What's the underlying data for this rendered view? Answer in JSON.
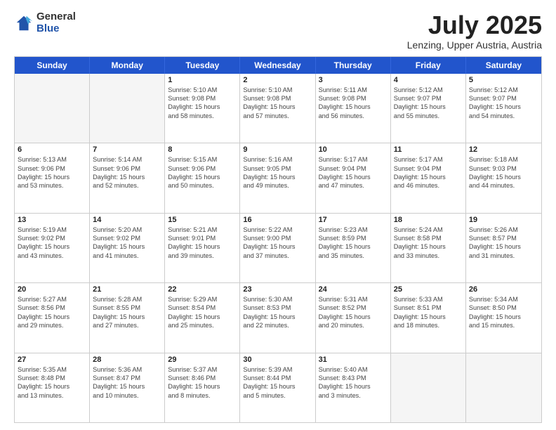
{
  "logo": {
    "general": "General",
    "blue": "Blue"
  },
  "header": {
    "title": "July 2025",
    "subtitle": "Lenzing, Upper Austria, Austria"
  },
  "weekdays": [
    "Sunday",
    "Monday",
    "Tuesday",
    "Wednesday",
    "Thursday",
    "Friday",
    "Saturday"
  ],
  "rows": [
    [
      {
        "day": "",
        "lines": [],
        "empty": true
      },
      {
        "day": "",
        "lines": [],
        "empty": true
      },
      {
        "day": "1",
        "lines": [
          "Sunrise: 5:10 AM",
          "Sunset: 9:08 PM",
          "Daylight: 15 hours",
          "and 58 minutes."
        ],
        "empty": false
      },
      {
        "day": "2",
        "lines": [
          "Sunrise: 5:10 AM",
          "Sunset: 9:08 PM",
          "Daylight: 15 hours",
          "and 57 minutes."
        ],
        "empty": false
      },
      {
        "day": "3",
        "lines": [
          "Sunrise: 5:11 AM",
          "Sunset: 9:08 PM",
          "Daylight: 15 hours",
          "and 56 minutes."
        ],
        "empty": false
      },
      {
        "day": "4",
        "lines": [
          "Sunrise: 5:12 AM",
          "Sunset: 9:07 PM",
          "Daylight: 15 hours",
          "and 55 minutes."
        ],
        "empty": false
      },
      {
        "day": "5",
        "lines": [
          "Sunrise: 5:12 AM",
          "Sunset: 9:07 PM",
          "Daylight: 15 hours",
          "and 54 minutes."
        ],
        "empty": false
      }
    ],
    [
      {
        "day": "6",
        "lines": [
          "Sunrise: 5:13 AM",
          "Sunset: 9:06 PM",
          "Daylight: 15 hours",
          "and 53 minutes."
        ],
        "empty": false
      },
      {
        "day": "7",
        "lines": [
          "Sunrise: 5:14 AM",
          "Sunset: 9:06 PM",
          "Daylight: 15 hours",
          "and 52 minutes."
        ],
        "empty": false
      },
      {
        "day": "8",
        "lines": [
          "Sunrise: 5:15 AM",
          "Sunset: 9:06 PM",
          "Daylight: 15 hours",
          "and 50 minutes."
        ],
        "empty": false
      },
      {
        "day": "9",
        "lines": [
          "Sunrise: 5:16 AM",
          "Sunset: 9:05 PM",
          "Daylight: 15 hours",
          "and 49 minutes."
        ],
        "empty": false
      },
      {
        "day": "10",
        "lines": [
          "Sunrise: 5:17 AM",
          "Sunset: 9:04 PM",
          "Daylight: 15 hours",
          "and 47 minutes."
        ],
        "empty": false
      },
      {
        "day": "11",
        "lines": [
          "Sunrise: 5:17 AM",
          "Sunset: 9:04 PM",
          "Daylight: 15 hours",
          "and 46 minutes."
        ],
        "empty": false
      },
      {
        "day": "12",
        "lines": [
          "Sunrise: 5:18 AM",
          "Sunset: 9:03 PM",
          "Daylight: 15 hours",
          "and 44 minutes."
        ],
        "empty": false
      }
    ],
    [
      {
        "day": "13",
        "lines": [
          "Sunrise: 5:19 AM",
          "Sunset: 9:02 PM",
          "Daylight: 15 hours",
          "and 43 minutes."
        ],
        "empty": false
      },
      {
        "day": "14",
        "lines": [
          "Sunrise: 5:20 AM",
          "Sunset: 9:02 PM",
          "Daylight: 15 hours",
          "and 41 minutes."
        ],
        "empty": false
      },
      {
        "day": "15",
        "lines": [
          "Sunrise: 5:21 AM",
          "Sunset: 9:01 PM",
          "Daylight: 15 hours",
          "and 39 minutes."
        ],
        "empty": false
      },
      {
        "day": "16",
        "lines": [
          "Sunrise: 5:22 AM",
          "Sunset: 9:00 PM",
          "Daylight: 15 hours",
          "and 37 minutes."
        ],
        "empty": false
      },
      {
        "day": "17",
        "lines": [
          "Sunrise: 5:23 AM",
          "Sunset: 8:59 PM",
          "Daylight: 15 hours",
          "and 35 minutes."
        ],
        "empty": false
      },
      {
        "day": "18",
        "lines": [
          "Sunrise: 5:24 AM",
          "Sunset: 8:58 PM",
          "Daylight: 15 hours",
          "and 33 minutes."
        ],
        "empty": false
      },
      {
        "day": "19",
        "lines": [
          "Sunrise: 5:26 AM",
          "Sunset: 8:57 PM",
          "Daylight: 15 hours",
          "and 31 minutes."
        ],
        "empty": false
      }
    ],
    [
      {
        "day": "20",
        "lines": [
          "Sunrise: 5:27 AM",
          "Sunset: 8:56 PM",
          "Daylight: 15 hours",
          "and 29 minutes."
        ],
        "empty": false
      },
      {
        "day": "21",
        "lines": [
          "Sunrise: 5:28 AM",
          "Sunset: 8:55 PM",
          "Daylight: 15 hours",
          "and 27 minutes."
        ],
        "empty": false
      },
      {
        "day": "22",
        "lines": [
          "Sunrise: 5:29 AM",
          "Sunset: 8:54 PM",
          "Daylight: 15 hours",
          "and 25 minutes."
        ],
        "empty": false
      },
      {
        "day": "23",
        "lines": [
          "Sunrise: 5:30 AM",
          "Sunset: 8:53 PM",
          "Daylight: 15 hours",
          "and 22 minutes."
        ],
        "empty": false
      },
      {
        "day": "24",
        "lines": [
          "Sunrise: 5:31 AM",
          "Sunset: 8:52 PM",
          "Daylight: 15 hours",
          "and 20 minutes."
        ],
        "empty": false
      },
      {
        "day": "25",
        "lines": [
          "Sunrise: 5:33 AM",
          "Sunset: 8:51 PM",
          "Daylight: 15 hours",
          "and 18 minutes."
        ],
        "empty": false
      },
      {
        "day": "26",
        "lines": [
          "Sunrise: 5:34 AM",
          "Sunset: 8:50 PM",
          "Daylight: 15 hours",
          "and 15 minutes."
        ],
        "empty": false
      }
    ],
    [
      {
        "day": "27",
        "lines": [
          "Sunrise: 5:35 AM",
          "Sunset: 8:48 PM",
          "Daylight: 15 hours",
          "and 13 minutes."
        ],
        "empty": false
      },
      {
        "day": "28",
        "lines": [
          "Sunrise: 5:36 AM",
          "Sunset: 8:47 PM",
          "Daylight: 15 hours",
          "and 10 minutes."
        ],
        "empty": false
      },
      {
        "day": "29",
        "lines": [
          "Sunrise: 5:37 AM",
          "Sunset: 8:46 PM",
          "Daylight: 15 hours",
          "and 8 minutes."
        ],
        "empty": false
      },
      {
        "day": "30",
        "lines": [
          "Sunrise: 5:39 AM",
          "Sunset: 8:44 PM",
          "Daylight: 15 hours",
          "and 5 minutes."
        ],
        "empty": false
      },
      {
        "day": "31",
        "lines": [
          "Sunrise: 5:40 AM",
          "Sunset: 8:43 PM",
          "Daylight: 15 hours",
          "and 3 minutes."
        ],
        "empty": false
      },
      {
        "day": "",
        "lines": [],
        "empty": true
      },
      {
        "day": "",
        "lines": [],
        "empty": true
      }
    ]
  ]
}
